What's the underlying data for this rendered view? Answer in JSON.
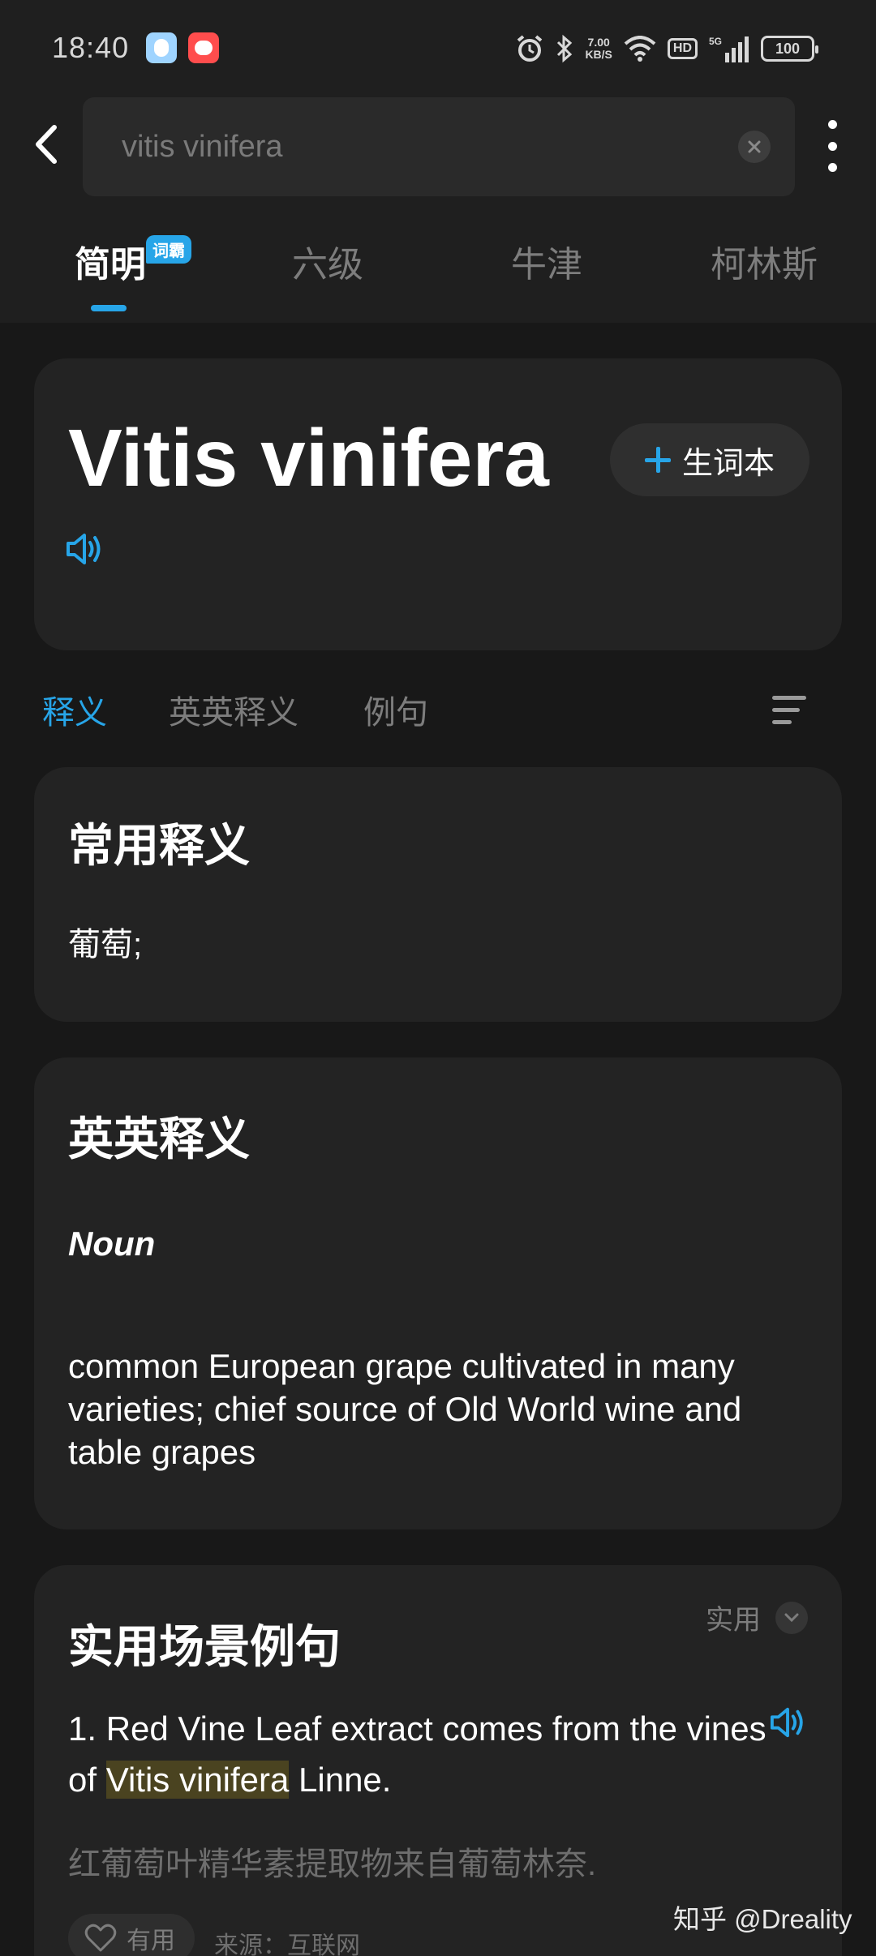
{
  "status_bar": {
    "time": "18:40",
    "net_speed_value": "7.00",
    "net_speed_unit": "KB/S",
    "hd_label": "HD",
    "battery": "100"
  },
  "search": {
    "value": "vitis vinifera"
  },
  "dict_tabs": {
    "items": [
      {
        "label": "简明",
        "active": true,
        "badge": "词霸"
      },
      {
        "label": "六级",
        "active": false
      },
      {
        "label": "牛津",
        "active": false
      },
      {
        "label": "柯林斯",
        "active": false
      }
    ]
  },
  "word": {
    "headword": "Vitis vinifera",
    "add_label": "生词本"
  },
  "section_tabs": {
    "items": [
      {
        "label": "释义",
        "active": true
      },
      {
        "label": "英英释义",
        "active": false
      },
      {
        "label": "例句",
        "active": false
      }
    ]
  },
  "common": {
    "title": "常用释义",
    "definition": "葡萄;"
  },
  "english": {
    "title": "英英释义",
    "pos": "Noun",
    "definition": "common European grape cultivated in many varieties; chief source of Old World wine and table grapes"
  },
  "examples": {
    "title": "实用场景例句",
    "filter_label": "实用",
    "items": [
      {
        "prefix": "1. Red Vine Leaf extract comes from the vines of ",
        "highlight": "Vitis vinifera",
        "suffix": " Linne.",
        "translation": "红葡萄叶精华素提取物来自葡萄林奈.",
        "useful_label": "有用",
        "source": "来源：互联网"
      }
    ]
  },
  "watermark": "知乎 @Dreality",
  "colors": {
    "accent": "#27a5e8",
    "background": "#181818",
    "card": "#232323",
    "highlight": "#4a4320"
  }
}
